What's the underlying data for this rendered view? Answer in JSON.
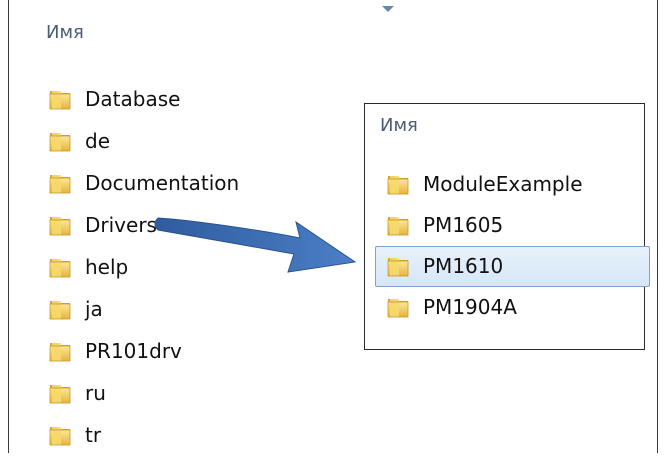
{
  "left_panel": {
    "column_header": "Имя",
    "items": [
      {
        "label": "Database"
      },
      {
        "label": "de"
      },
      {
        "label": "Documentation"
      },
      {
        "label": "Drivers"
      },
      {
        "label": "help"
      },
      {
        "label": "ja"
      },
      {
        "label": "PR101drv"
      },
      {
        "label": "ru"
      },
      {
        "label": "tr"
      }
    ]
  },
  "right_panel": {
    "column_header": "Имя",
    "items": [
      {
        "label": "ModuleExample"
      },
      {
        "label": "PM1605"
      },
      {
        "label": "PM1610",
        "selected": true
      },
      {
        "label": "PM1904A"
      }
    ]
  },
  "colors": {
    "header_text": "#4b5d75",
    "folder_yellow": "#f3cf5b",
    "arrow_blue": "#3f6fb5",
    "selection_border": "#7da2ce"
  }
}
